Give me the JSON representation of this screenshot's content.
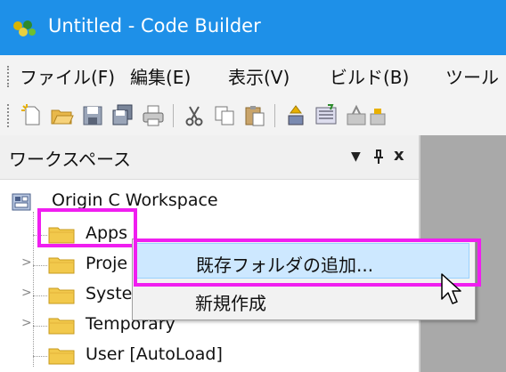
{
  "window": {
    "title": "Untitled - Code Builder"
  },
  "menu": {
    "items": [
      {
        "label": "ファイル(F)"
      },
      {
        "label": "編集(E)"
      },
      {
        "label": "表示(V)"
      },
      {
        "label": "ビルド(B)"
      },
      {
        "label": "ツール"
      }
    ]
  },
  "toolbar": {
    "buttons": [
      "new-file-icon",
      "open-folder-icon",
      "save-icon",
      "save-all-icon",
      "print-icon",
      "cut-icon",
      "copy-icon",
      "paste-icon",
      "build-icon",
      "rebuild-icon",
      "debug-icon",
      "run-icon"
    ]
  },
  "workspace_panel": {
    "title": "ワークスペース",
    "controls": {
      "dropdown": "▼",
      "pin": "ᵖ",
      "close": "x"
    }
  },
  "tree": {
    "root": "Origin C Workspace",
    "items": [
      {
        "label": "Apps"
      },
      {
        "label": "Proje"
      },
      {
        "label": "Syste"
      },
      {
        "label": "Temporary"
      },
      {
        "label": "User  [AutoLoad]"
      }
    ]
  },
  "context_menu": {
    "items": [
      {
        "label": "既存フォルダの追加..."
      },
      {
        "label": "新規作成"
      }
    ]
  },
  "colors": {
    "titlebar": "#1e90e8",
    "highlight": "#f01ef0",
    "folder": "#f2c94c",
    "menu_hover": "#cde8ff"
  }
}
